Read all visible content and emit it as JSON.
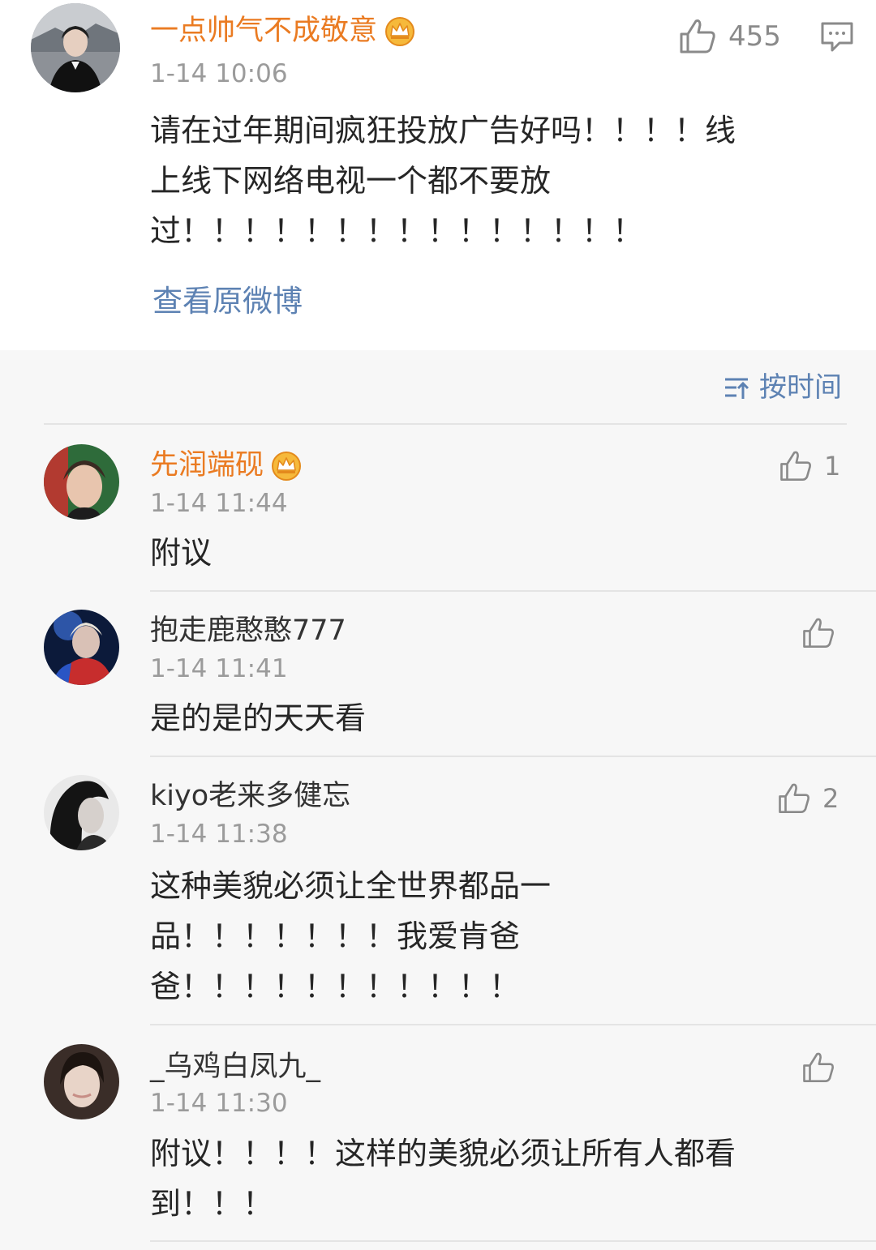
{
  "main_comment": {
    "username": "一点帅气不成敬意",
    "timestamp": "1-14 10:06",
    "like_count": "455",
    "lines": [
      "请在过年期间疯狂投放广告好吗！！！！线",
      "上线下网络电视一个都不要放",
      "过！！！！！！！！！！！！！！！"
    ],
    "view_original": "查看原微博"
  },
  "sort": {
    "label": "按时间"
  },
  "replies": [
    {
      "username": "先润端砚",
      "vip": true,
      "timestamp": "1-14 11:44",
      "like_count": "1",
      "lines": [
        "附议"
      ]
    },
    {
      "username": "抱走鹿憨憨777",
      "vip": false,
      "timestamp": "1-14 11:41",
      "like_count": "",
      "lines": [
        "是的是的天天看"
      ]
    },
    {
      "username": "kiyo老来多健忘",
      "vip": false,
      "timestamp": "1-14 11:38",
      "like_count": "2",
      "lines": [
        "这种美貌必须让全世界都品一",
        "品！！！！！！！我爱肯爸",
        "爸！！！！！！！！！！！"
      ]
    },
    {
      "username": "_乌鸡白凤九_",
      "vip": false,
      "timestamp": "1-14 11:30",
      "like_count": "",
      "lines": [
        "附议！！！！这样的美貌必须让所有人都看",
        "到！！！"
      ]
    }
  ],
  "colors": {
    "vip_name": "#ea7b22",
    "link": "#5d82b3",
    "timestamp": "#9b9b9b",
    "reply_background": "#f7f7f7"
  }
}
